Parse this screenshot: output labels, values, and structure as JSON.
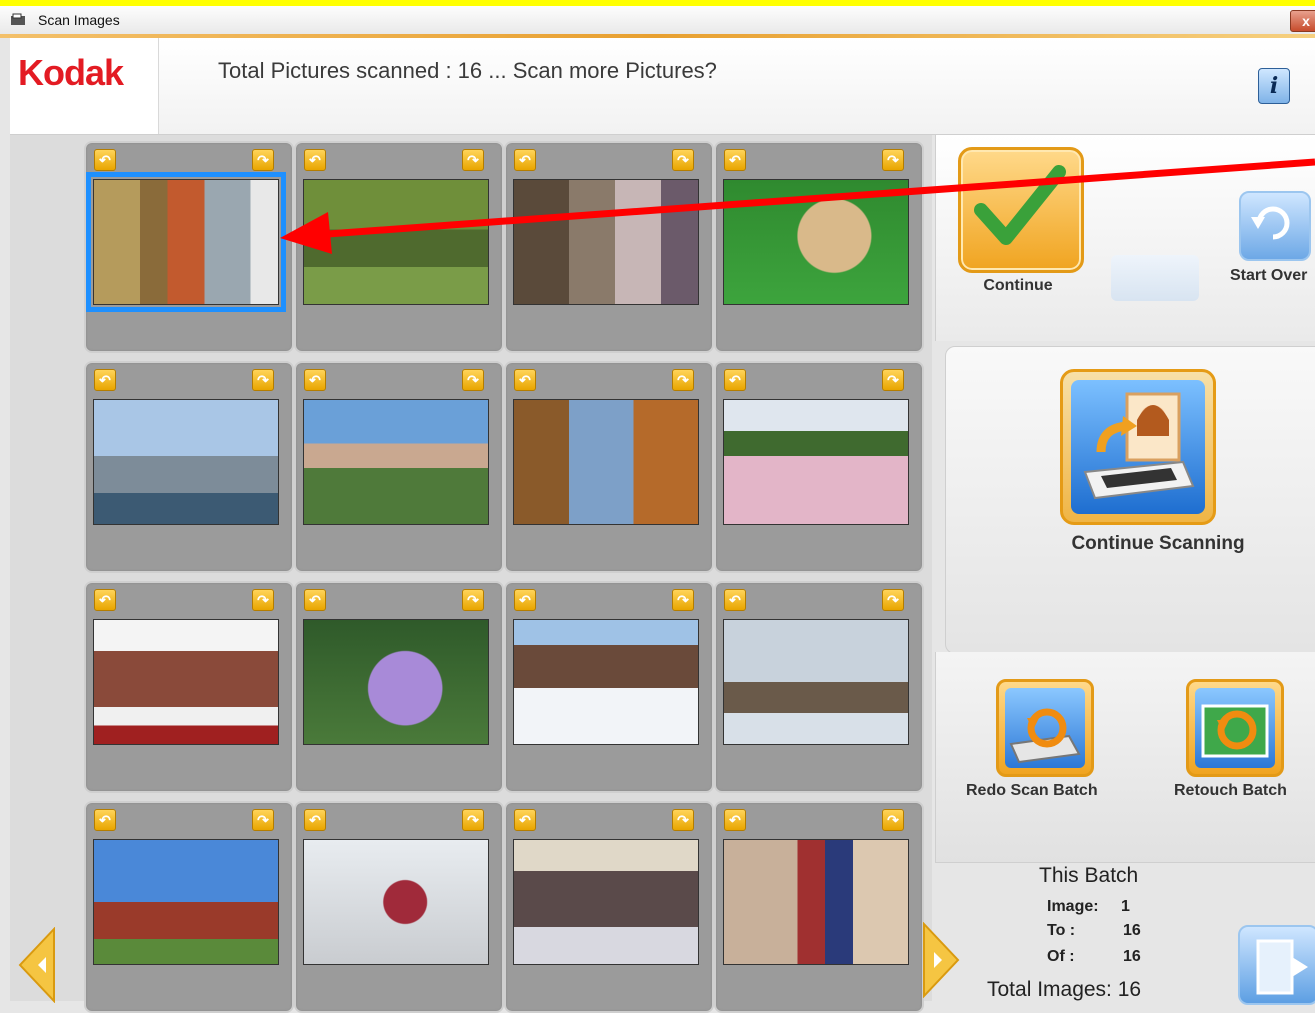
{
  "window": {
    "title": "Scan Images",
    "close_label": "x"
  },
  "header": {
    "logo": "Kodak",
    "message": "Total Pictures scanned : 16 ... Scan more Pictures?",
    "info_label": "i"
  },
  "thumbnails": [
    {
      "selected": true
    },
    {
      "selected": false
    },
    {
      "selected": false
    },
    {
      "selected": false
    },
    {
      "selected": false
    },
    {
      "selected": false
    },
    {
      "selected": false
    },
    {
      "selected": false
    },
    {
      "selected": false
    },
    {
      "selected": false
    },
    {
      "selected": false
    },
    {
      "selected": false
    },
    {
      "selected": false
    },
    {
      "selected": false
    },
    {
      "selected": false
    },
    {
      "selected": false
    }
  ],
  "actions": {
    "continue_label": "Continue",
    "start_over_label": "Start Over",
    "continue_scanning_label": "Continue Scanning",
    "redo_scan_batch_label": "Redo Scan Batch",
    "retouch_batch_label": "Retouch Batch"
  },
  "batch": {
    "title": "This Batch",
    "image_label": "Image:",
    "image_value": "1",
    "to_label": "To :",
    "to_value": "16",
    "of_label": "Of :",
    "of_value": "16",
    "total_label": "Total Images: 16"
  },
  "colors": {
    "selection": "#1e90ff",
    "accent": "#f0a420",
    "brand": "#e31b23",
    "arrow": "#ff0000"
  }
}
